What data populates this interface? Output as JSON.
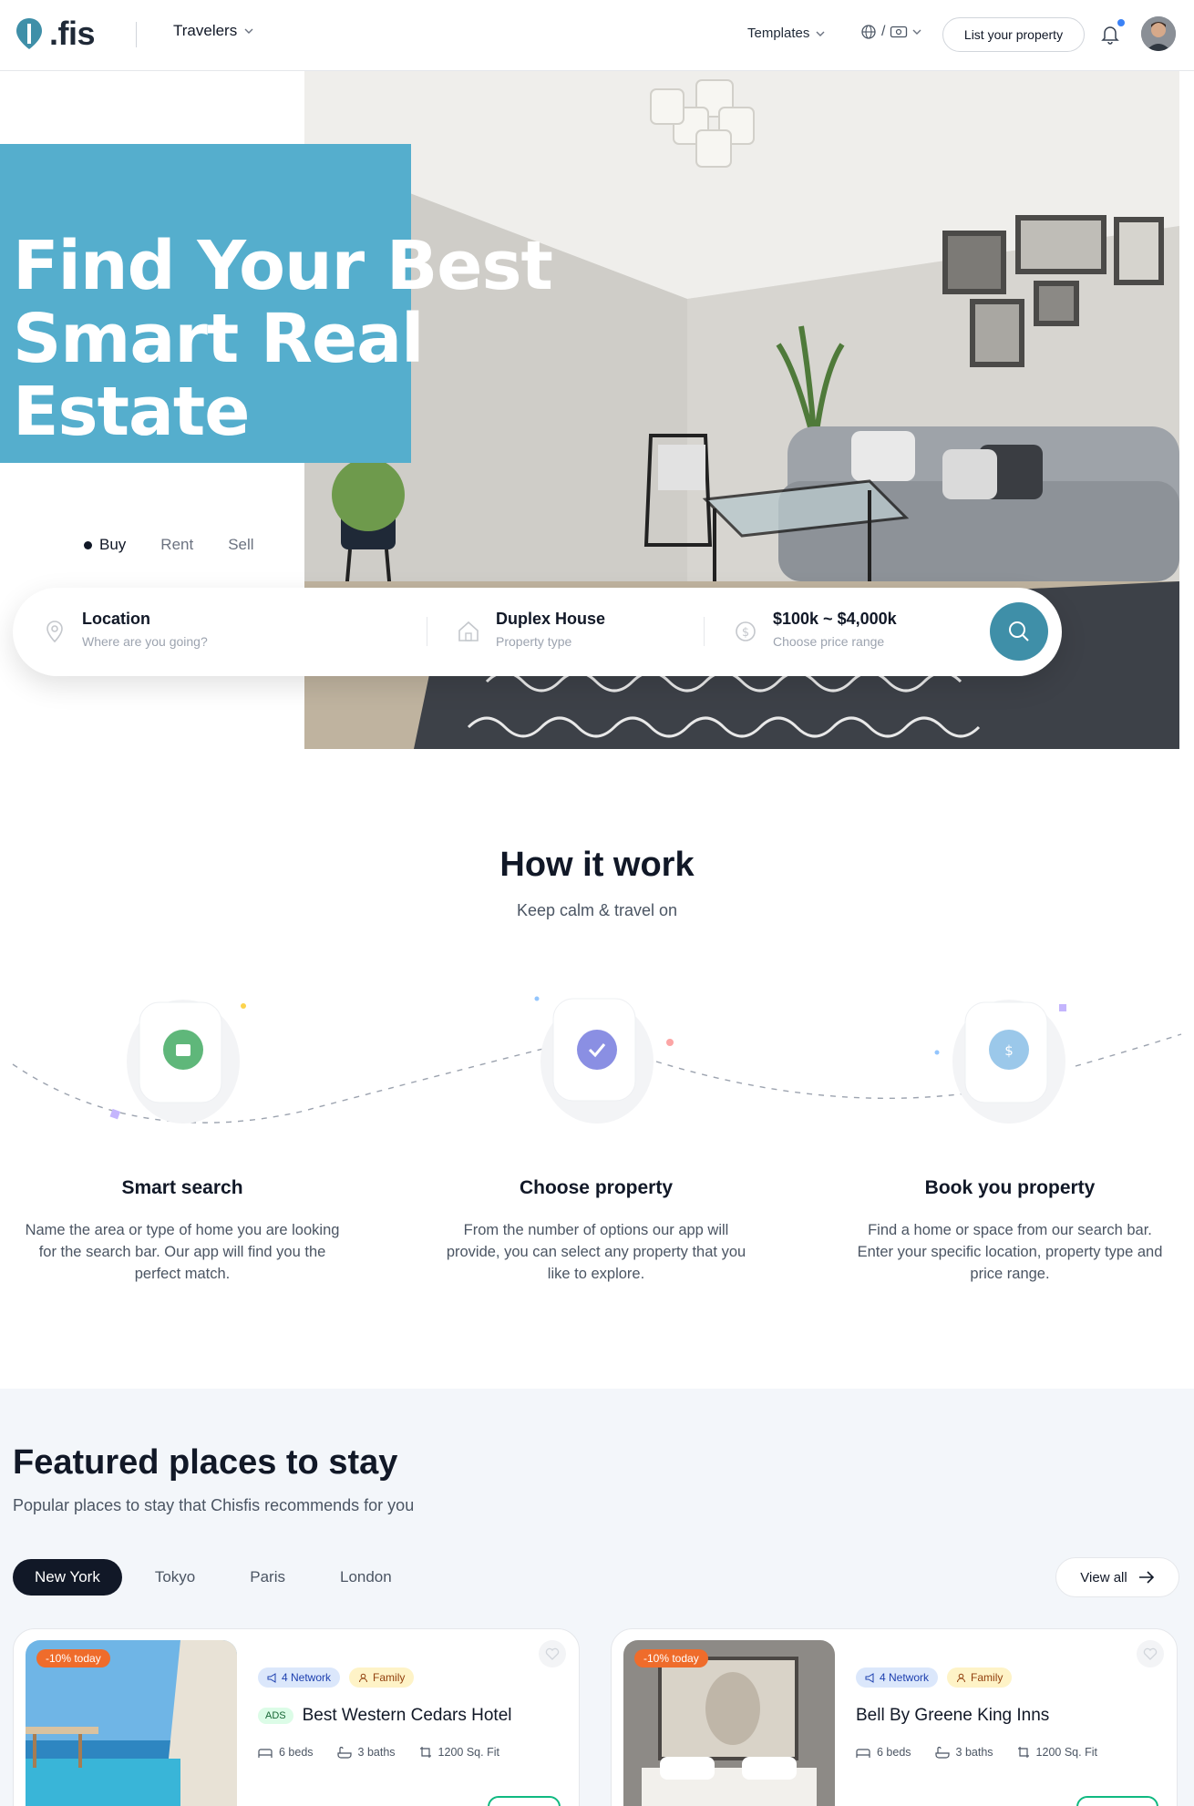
{
  "header": {
    "logo_text": ".fis",
    "travelers_label": "Travelers",
    "templates_label": "Templates",
    "lang_separator": "/",
    "list_property_label": "List your property"
  },
  "hero": {
    "title_line1": "Find Your Best",
    "title_line2": "Smart Real Estate",
    "tabs": [
      {
        "label": "Buy",
        "active": true
      },
      {
        "label": "Rent",
        "active": false
      },
      {
        "label": "Sell",
        "active": false
      }
    ],
    "search": {
      "location_title": "Location",
      "location_sub": "Where are you going?",
      "type_title": "Duplex House",
      "type_sub": "Property type",
      "price_title": "$100k ~ $4,000k",
      "price_sub": "Choose price range"
    }
  },
  "how": {
    "title": "How it work",
    "subtitle": "Keep calm & travel on",
    "steps": [
      {
        "title": "Smart search",
        "desc": "Name the area or type of home you are looking for the search bar. Our app will find you the perfect match.",
        "color": "#5fb77a"
      },
      {
        "title": "Choose property",
        "desc": "From the number of options our app will provide, you can select any property that you like to explore.",
        "color": "#8a8fe3"
      },
      {
        "title": "Book you property",
        "desc": "Find a home or space from our search bar. Enter your specific location, property type and price range.",
        "color": "#9bc8ea"
      }
    ]
  },
  "featured": {
    "title": "Featured places to stay",
    "subtitle": "Popular places to stay that Chisfis recommends for you",
    "city_tabs": [
      "New York",
      "Tokyo",
      "Paris",
      "London"
    ],
    "view_all_label": "View all",
    "cards": [
      {
        "discount": "-10% today",
        "network": "4 Network",
        "tag": "Family",
        "ads": "ADS",
        "name": "Best Western Cedars Hotel",
        "beds": "6 beds",
        "baths": "3 baths",
        "area": "1200 Sq. Fit"
      },
      {
        "discount": "-10% today",
        "network": "4 Network",
        "tag": "Family",
        "name": "Bell By Greene King Inns",
        "beds": "6 beds",
        "baths": "3 baths",
        "area": "1200 Sq. Fit"
      }
    ]
  },
  "colors": {
    "hero_blue": "#55aecd",
    "search_button": "#3f8fa8",
    "dark": "#111827",
    "discount": "#ef6c2b",
    "price_border": "#10b981"
  }
}
